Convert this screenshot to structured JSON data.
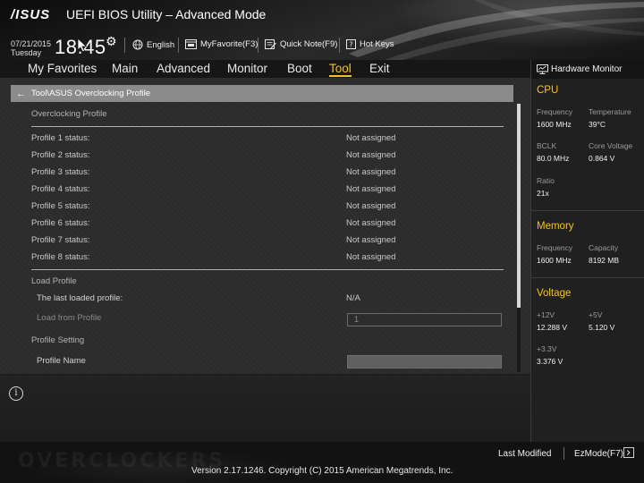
{
  "header": {
    "logo": "/ISUS",
    "title": "UEFI BIOS Utility – Advanced Mode",
    "date": "07/21/2015",
    "day": "Tuesday",
    "time": "18:45",
    "language": "English",
    "my_favorite": "MyFavorite(F3)",
    "quick_note": "Quick Note(F9)",
    "hot_keys": "Hot Keys"
  },
  "menu": {
    "items": [
      "My Favorites",
      "Main",
      "Advanced",
      "Monitor",
      "Boot",
      "Tool",
      "Exit"
    ],
    "active": "Tool"
  },
  "breadcrumb": "Tool\\ASUS Overclocking Profile",
  "main": {
    "overclocking_profile_title": "Overclocking Profile",
    "profiles": [
      {
        "label": "Profile 1 status:",
        "value": "Not assigned"
      },
      {
        "label": "Profile 2 status:",
        "value": "Not assigned"
      },
      {
        "label": "Profile 3 status:",
        "value": "Not assigned"
      },
      {
        "label": "Profile 4 status:",
        "value": "Not assigned"
      },
      {
        "label": "Profile 5 status:",
        "value": "Not assigned"
      },
      {
        "label": "Profile 6 status:",
        "value": "Not assigned"
      },
      {
        "label": "Profile 7 status:",
        "value": "Not assigned"
      },
      {
        "label": "Profile 8 status:",
        "value": "Not assigned"
      }
    ],
    "load_profile_title": "Load Profile",
    "last_loaded_label": "The last loaded profile:",
    "last_loaded_value": "N/A",
    "load_from_label": "Load from Profile",
    "load_from_value": "1",
    "profile_setting_title": "Profile Setting",
    "profile_name_label": "Profile Name",
    "profile_name_value": ""
  },
  "hardware_monitor": {
    "title": "Hardware Monitor",
    "cpu": {
      "title": "CPU",
      "frequency_label": "Frequency",
      "frequency_value": "1600 MHz",
      "temperature_label": "Temperature",
      "temperature_value": "39°C",
      "bclk_label": "BCLK",
      "bclk_value": "80.0 MHz",
      "core_voltage_label": "Core Voltage",
      "core_voltage_value": "0.864 V",
      "ratio_label": "Ratio",
      "ratio_value": "21x"
    },
    "memory": {
      "title": "Memory",
      "frequency_label": "Frequency",
      "frequency_value": "1600 MHz",
      "capacity_label": "Capacity",
      "capacity_value": "8192 MB"
    },
    "voltage": {
      "title": "Voltage",
      "v12_label": "+12V",
      "v12_value": "12.288 V",
      "v5_label": "+5V",
      "v5_value": "5.120 V",
      "v33_label": "+3.3V",
      "v33_value": "3.376 V"
    }
  },
  "footer": {
    "watermark": "OVERCLOCKERS",
    "version": "Version 2.17.1246. Copyright (C) 2015 American Megatrends, Inc.",
    "last_modified": "Last Modified",
    "ez_mode": "EzMode(F7)"
  },
  "colors": {
    "accent": "#f7c21e",
    "breadcrumb_bar": "#8b8b8b",
    "panel": "#2b2b2b"
  }
}
